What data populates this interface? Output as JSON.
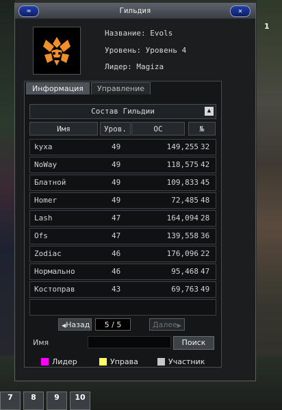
{
  "window": {
    "title": "Гильдия"
  },
  "guild": {
    "name_label": "Название: Evols",
    "level_label": "Уровень: Уровень 4",
    "leader_label": "Лидер: Magiza"
  },
  "tabs": [
    {
      "label": "Информация",
      "active": true
    },
    {
      "label": "Управление",
      "active": false
    }
  ],
  "roster": {
    "title": "Состав Гильдии",
    "columns": {
      "name": "Имя",
      "level": "Уров.",
      "os": "ОС",
      "num": "№"
    },
    "sort_indicator": "▼",
    "members": [
      {
        "name": "kyxa",
        "level": "49",
        "os": "149,255",
        "num": "32"
      },
      {
        "name": "NoWay",
        "level": "49",
        "os": "118,575",
        "num": "42"
      },
      {
        "name": "Блатной",
        "level": "49",
        "os": "109,833",
        "num": "45"
      },
      {
        "name": "Homer",
        "level": "49",
        "os": "72,485",
        "num": "48"
      },
      {
        "name": "Lash",
        "level": "47",
        "os": "164,094",
        "num": "28"
      },
      {
        "name": "Ofs",
        "level": "47",
        "os": "139,558",
        "num": "36"
      },
      {
        "name": "Zodiac",
        "level": "46",
        "os": "176,096",
        "num": "22"
      },
      {
        "name": "Нормально",
        "level": "46",
        "os": "95,468",
        "num": "47"
      },
      {
        "name": "Костоправ",
        "level": "43",
        "os": "69,763",
        "num": "49"
      }
    ]
  },
  "pager": {
    "prev": "Назад",
    "page": "5 / 5",
    "next": "Далее"
  },
  "search": {
    "label": "Имя",
    "value": "",
    "button": "Поиск"
  },
  "legend": [
    {
      "label": "Лидер",
      "color": "#ff00ff"
    },
    {
      "label": "Управа",
      "color": "#ffff66"
    },
    {
      "label": "Участник",
      "color": "#c8c8c8"
    }
  ],
  "hotbar": [
    "7",
    "8",
    "9",
    "10"
  ],
  "hud": {
    "mark": "1"
  },
  "colors": {
    "window_bg": "#1b1d1f",
    "title_bar": "#4d5259",
    "tab_active": "#4d5259"
  }
}
